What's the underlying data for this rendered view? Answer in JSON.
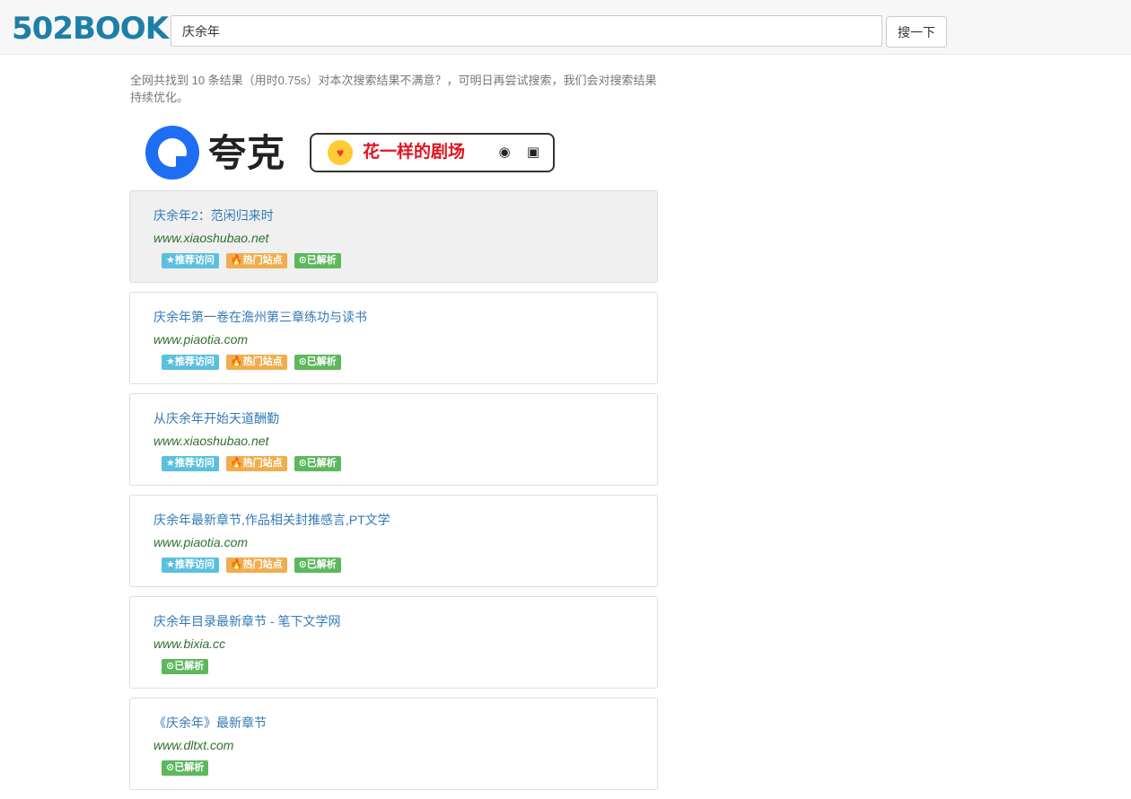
{
  "header": {
    "logo": "502BOOK",
    "search_value": "庆余年",
    "search_button": "搜一下"
  },
  "summary": "全网共找到 10 条结果（用时0.75s）对本次搜索结果不满意？，可明日再尝试搜索，我们会对搜索结果持续优化。",
  "banner": {
    "brand": "夸克",
    "promo_text": "花一样的剧场"
  },
  "badges": {
    "recommend": "★推荐访问",
    "hot": "热门站点",
    "parsed": "已解析"
  },
  "results": [
    {
      "title": "庆余年2：范闲归来时",
      "url": "www.xiaoshubao.net",
      "tags": [
        "recommend",
        "hot",
        "parsed"
      ]
    },
    {
      "title": "庆余年第一卷在澹州第三章练功与读书",
      "url": "www.piaotia.com",
      "tags": [
        "recommend",
        "hot",
        "parsed"
      ]
    },
    {
      "title": "从庆余年开始天道酬勤",
      "url": "www.xiaoshubao.net",
      "tags": [
        "recommend",
        "hot",
        "parsed"
      ]
    },
    {
      "title": "庆余年最新章节,作品相关封推感言,PT文学",
      "url": "www.piaotia.com",
      "tags": [
        "recommend",
        "hot",
        "parsed"
      ]
    },
    {
      "title": "庆余年目录最新章节 - 笔下文学网",
      "url": "www.bixia.cc",
      "tags": [
        "parsed"
      ]
    },
    {
      "title": "《庆余年》最新章节",
      "url": "www.dltxt.com",
      "tags": [
        "parsed"
      ]
    }
  ]
}
